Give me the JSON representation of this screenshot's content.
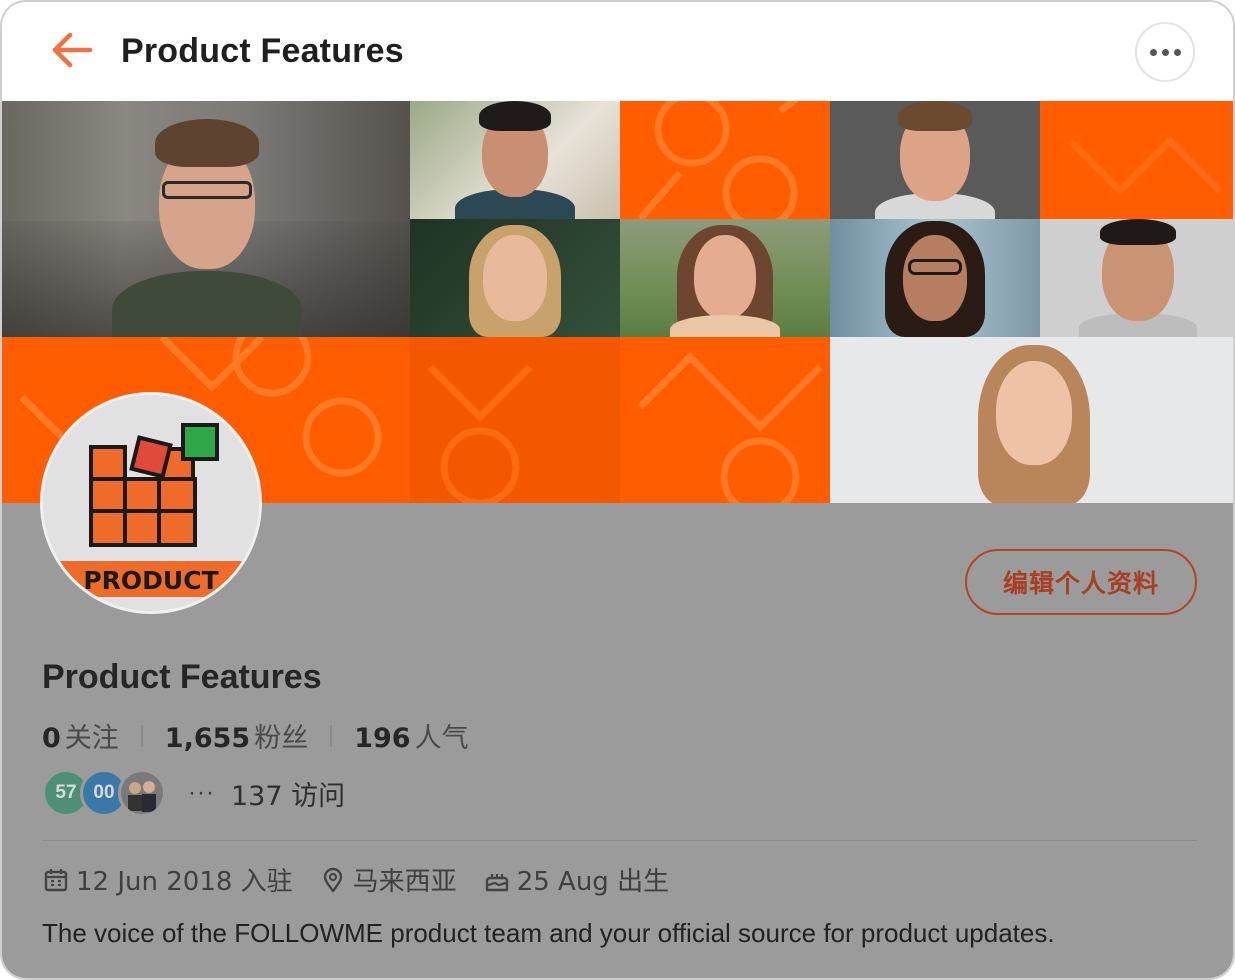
{
  "header": {
    "title": "Product Features",
    "back_icon": "arrow-left-icon",
    "more_icon": "more-horizontal-icon",
    "accent": "#f0733f"
  },
  "cover": {
    "brand_color": "#ff5d00"
  },
  "avatar": {
    "logo_text": "PRODUCT"
  },
  "profile": {
    "edit_label": "编辑个人资料",
    "name": "Product Features",
    "stats": [
      {
        "value": "0",
        "label": "关注"
      },
      {
        "value": "1,655",
        "label": "粉丝"
      },
      {
        "value": "196",
        "label": "人气"
      }
    ],
    "visitors": [
      {
        "text": "57"
      },
      {
        "text": "00"
      },
      {
        "text": ""
      }
    ],
    "visits_more": "···",
    "visits_label": "137 访问",
    "meta": {
      "joined": "12 Jun 2018 入驻",
      "location": "马来西亚",
      "birthday": "25 Aug 出生"
    },
    "bio": "The voice of the FOLLOWME product team and your official source for product updates."
  }
}
